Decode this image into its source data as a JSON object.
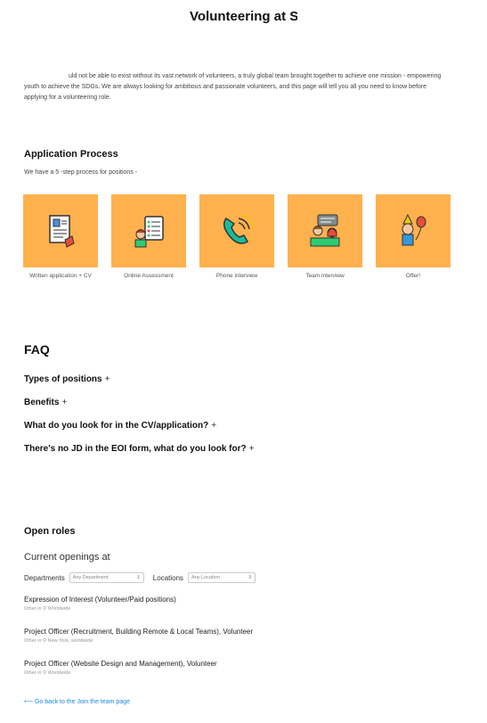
{
  "page_title": "Volunteering at S",
  "intro_text": "uld not be able to exist without its vast network of volunteers, a truly global team brought together to achieve one mission - empowering youth to achieve the SDGs. We are always looking for ambitious and passionate volunteers, and this page will tell you all you need to know before applying for a volunteering role.",
  "application": {
    "heading": "Application Process",
    "subtext": "We have a 5 -step process for positions -",
    "steps": [
      {
        "label": "Written application + CV",
        "icon": "written-application-icon"
      },
      {
        "label": "Online Assessment",
        "icon": "online-assessment-icon"
      },
      {
        "label": "Phone interview",
        "icon": "phone-icon"
      },
      {
        "label": "Team interview",
        "icon": "team-interview-icon"
      },
      {
        "label": "Offer!",
        "icon": "celebration-icon"
      }
    ]
  },
  "faq": {
    "heading": "FAQ",
    "items": [
      "Types of positions",
      "Benefits",
      "What do you look for in the CV/application?",
      "There's no JD in the EOI form, what do you look for?"
    ],
    "toggle": "+"
  },
  "roles": {
    "heading": "Open roles",
    "openings_title": "Current openings at",
    "departments_label": "Departments",
    "departments_value": "Any Department",
    "locations_label": "Locations",
    "locations_value": "Any Location",
    "items": [
      {
        "title": "Expression of Interest (Volunteer/Paid positions)",
        "dept": "Other in",
        "location": "Worldwide"
      },
      {
        "title": "Project Officer (Recruitment, Building Remote & Local Teams), Volunteer",
        "dept": "Other in",
        "location": "New York, worldwide"
      },
      {
        "title": "Project Officer (Website Design and Management), Volunteer",
        "dept": "Other in",
        "location": "Worldwide"
      }
    ]
  },
  "back_link": "⟵ Go back to the Join the team page",
  "colors": {
    "tile": "#ffb14e",
    "link": "#1e88e5"
  }
}
